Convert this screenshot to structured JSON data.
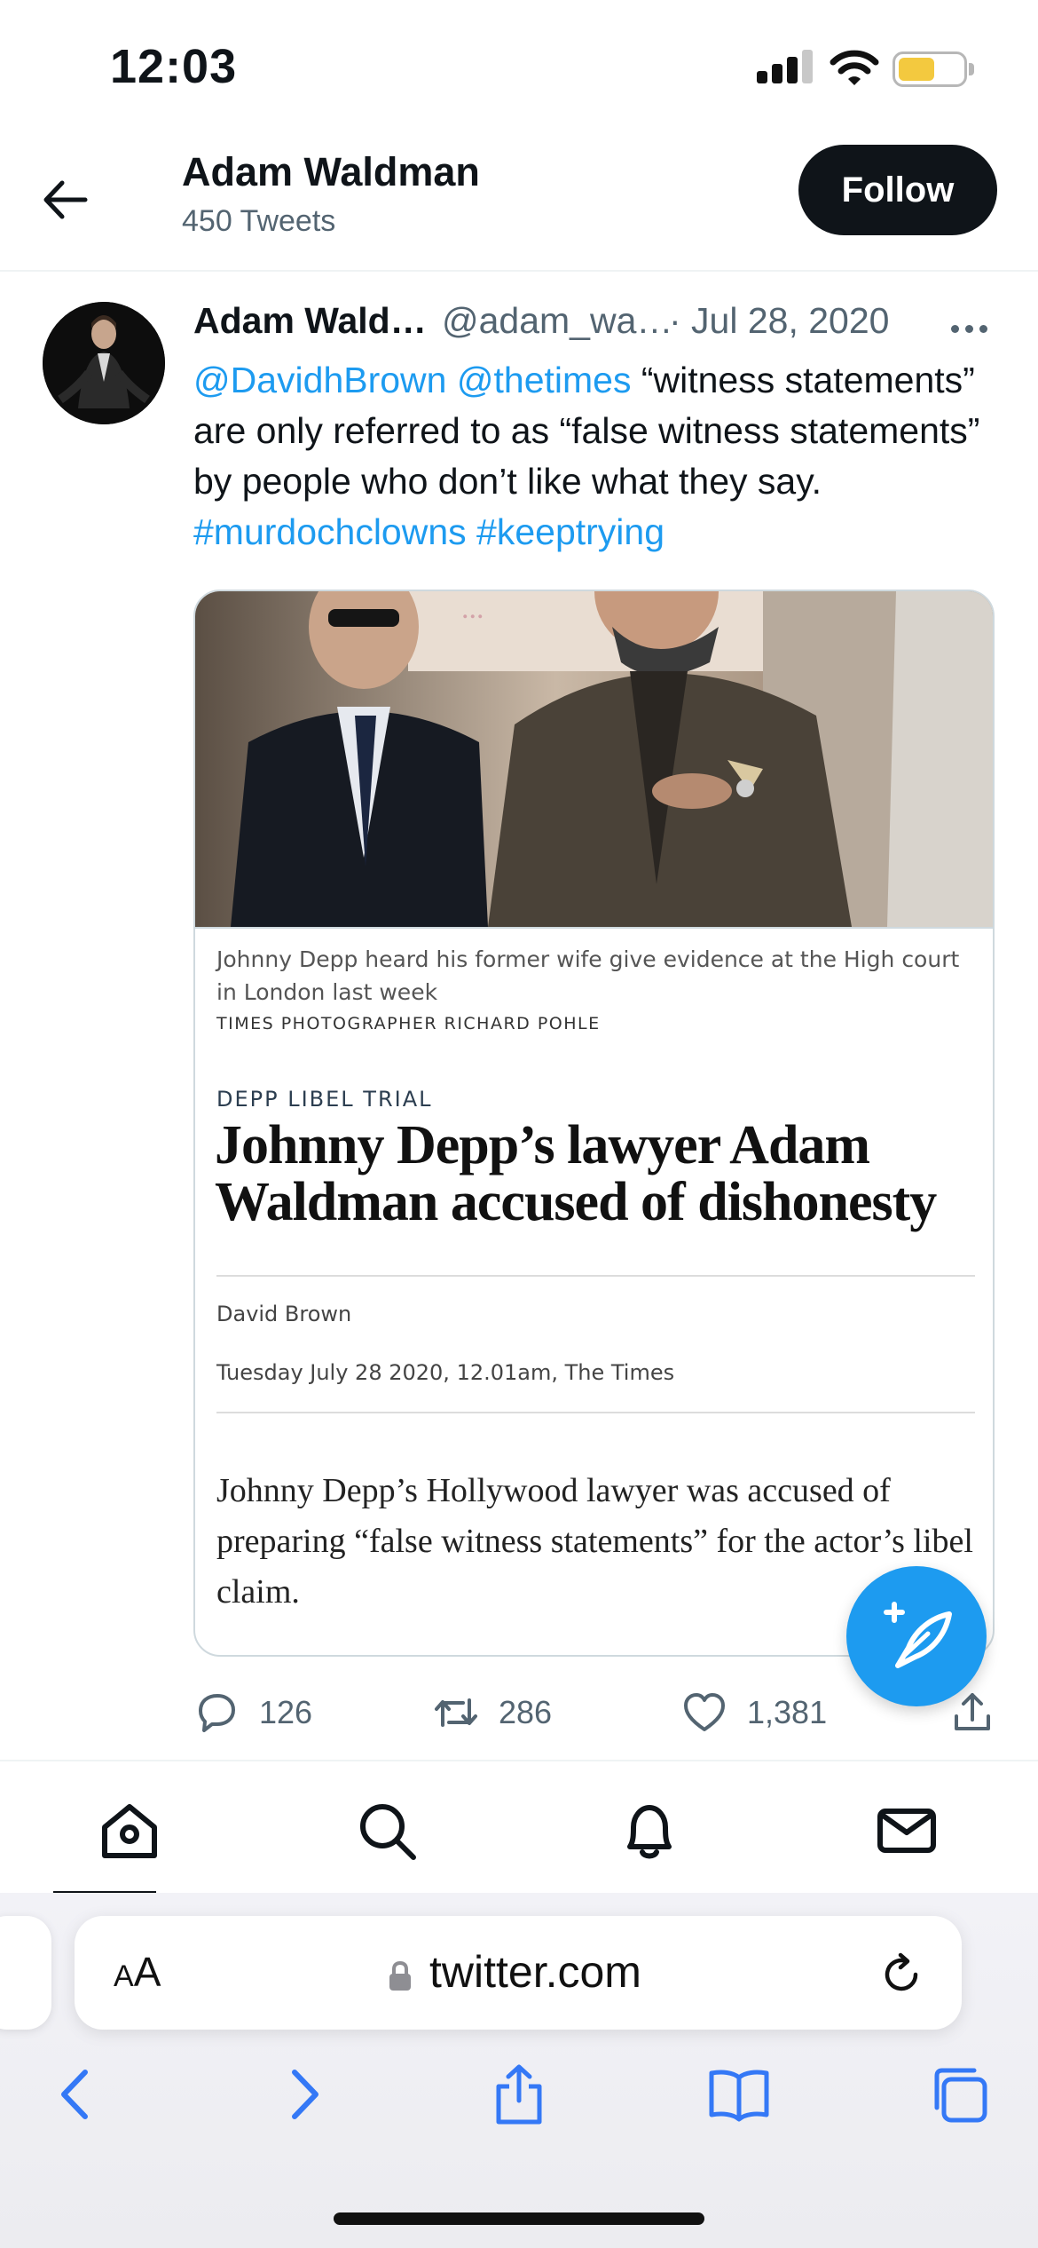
{
  "status_bar": {
    "time": "12:03",
    "battery_level": 0.55,
    "battery_color": "#f3c93f"
  },
  "header": {
    "name": "Adam Waldman",
    "tweet_count": "450 Tweets",
    "follow_label": "Follow",
    "back_icon": "arrow-left-icon"
  },
  "tweet": {
    "author_name": "Adam Wald…",
    "author_handle": "@adam_wa…",
    "date": "· Jul 28, 2020",
    "more_icon": "more-options-icon",
    "text": {
      "mention_1": "@DavidhBrown",
      "mention_2": "@thetimes",
      "body": "“witness statements” are only referred to as “false witness statements” by people who don’t like what they say.",
      "hashtag_1": "#murdochclowns",
      "hashtag_2": "#keeptrying"
    },
    "card": {
      "photo_caption": "Johnny Depp heard his former wife give evidence at the High court in London last week",
      "photo_credit": "TIMES PHOTOGRAPHER RICHARD POHLE",
      "section": "DEPP LIBEL TRIAL",
      "title": "Johnny Depp’s lawyer Adam Waldman accused of dishonesty",
      "author": "David Brown",
      "dateline": "Tuesday July 28 2020, 12.01am, The Times",
      "summary": "Johnny Depp’s Hollywood lawyer was accused of preparing “false witness statements” for the actor’s libel claim."
    },
    "actions": {
      "replies": "126",
      "retweets": "286",
      "likes": "1,381"
    }
  },
  "twitter_nav": {
    "items": [
      "home-icon",
      "search-icon",
      "notifications-icon",
      "messages-icon"
    ],
    "active": "home"
  },
  "safari": {
    "aa_big": "A",
    "aa_small": "A",
    "url": "twitter.com",
    "toolbar": [
      "back-icon",
      "forward-icon",
      "share-icon",
      "bookmarks-icon",
      "tabs-icon"
    ]
  },
  "colors": {
    "accent": "#1d9bf0",
    "text_primary": "#0f1419",
    "text_secondary": "#536471",
    "safari_blue": "#3478f6"
  }
}
